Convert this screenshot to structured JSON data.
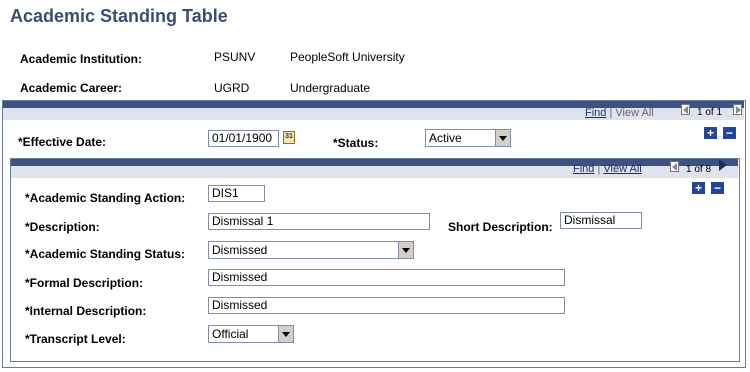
{
  "page": {
    "title": "Academic Standing Table"
  },
  "header": {
    "institution_label": "Academic Institution:",
    "institution_code": "PSUNV",
    "institution_name": "PeopleSoft University",
    "career_label": "Academic Career:",
    "career_code": "UGRD",
    "career_name": "Undergraduate"
  },
  "outer_nav": {
    "find": "Find",
    "sep": "|",
    "view_all": "View All",
    "count": "1 of 1"
  },
  "effective": {
    "date_label": "*Effective Date:",
    "date_value": "01/01/1900",
    "calendar_glyph": "31",
    "status_label": "*Status:",
    "status_value": "Active"
  },
  "inner_nav": {
    "find": "Find",
    "sep": "|",
    "view_all": "View All",
    "count": "1 of 8"
  },
  "buttons": {
    "add": "+",
    "remove": "−"
  },
  "fields": {
    "action_label": "*Academic Standing Action:",
    "action_value": "DIS1",
    "description_label": "*Description:",
    "description_value": "Dismissal 1",
    "short_desc_label": "Short Description:",
    "short_desc_value": "Dismissal",
    "status_label": "*Academic Standing Status:",
    "status_value": "Dismissed",
    "formal_label": "*Formal Description:",
    "formal_value": "Dismissed",
    "internal_label": "*Internal Description:",
    "internal_value": "Dismissed",
    "transcript_label": "*Transcript Level:",
    "transcript_value": "Official"
  }
}
